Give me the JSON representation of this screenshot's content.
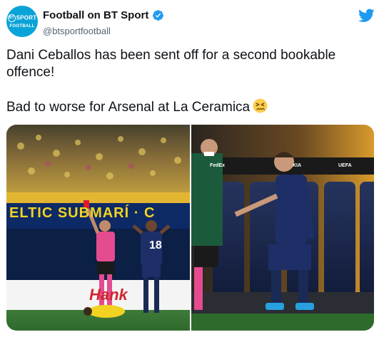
{
  "account": {
    "display_name": "Football on BT Sport",
    "handle": "@btsportfootball",
    "avatar_top": "SPORT",
    "avatar_bt": "BT",
    "avatar_bottom": "FOOTBALL",
    "verified": true
  },
  "tweet": {
    "line1": "Dani Ceballos has been sent off for a second bookable offence!",
    "line2": "Bad to worse for Arsenal at La Ceramica",
    "emoji": "confounded-face-emoji"
  },
  "media": {
    "left_photo": {
      "board_text": "ELTIC SUBMARÍ · C",
      "ad_text": "Hank",
      "shirt_number": "18"
    },
    "right_photo": {
      "sponsor_1": "FedEx",
      "sponsor_2": "KIA",
      "sponsor_3": "UEFA"
    }
  },
  "colors": {
    "twitter_blue": "#1d9bf0",
    "bt_sport_blue": "#0aa3d8",
    "text": "#0f1419",
    "secondary_text": "#536471"
  }
}
